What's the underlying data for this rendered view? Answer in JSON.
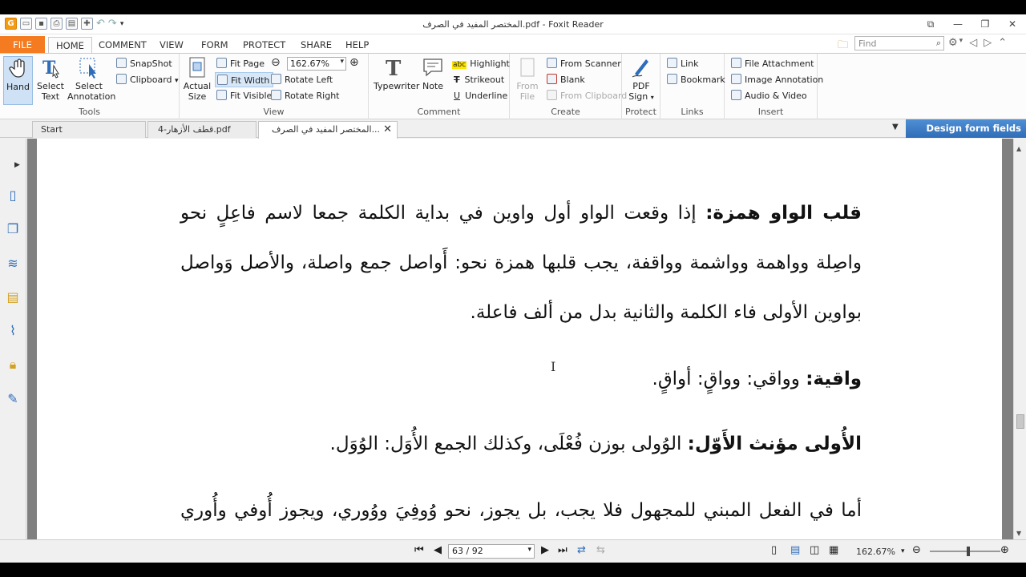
{
  "window": {
    "title": "المختصر المفيد في الصرف.pdf - Foxit Reader"
  },
  "ribbon_tabs": [
    "FILE",
    "HOME",
    "COMMENT",
    "VIEW",
    "FORM",
    "PROTECT",
    "SHARE",
    "HELP"
  ],
  "search": {
    "placeholder": "Find"
  },
  "ribbon": {
    "tools": {
      "label": "Tools",
      "hand": "Hand",
      "select_text": [
        "Select",
        "Text"
      ],
      "select_annotation": [
        "Select",
        "Annotation"
      ],
      "snapshot": "SnapShot",
      "clipboard": "Clipboard"
    },
    "view": {
      "label": "View",
      "actual_size": [
        "Actual",
        "Size"
      ],
      "fit_page": "Fit Page",
      "fit_width": "Fit Width",
      "fit_visible": "Fit Visible",
      "zoom_value": "162.67%",
      "rotate_left": "Rotate Left",
      "rotate_right": "Rotate Right"
    },
    "comment": {
      "label": "Comment",
      "typewriter": "Typewriter",
      "note": "Note",
      "highlight": "Highlight",
      "strikeout": "Strikeout",
      "underline": "Underline"
    },
    "create": {
      "label": "Create",
      "from_file": [
        "From",
        "File"
      ],
      "from_scanner": "From Scanner",
      "blank": "Blank",
      "from_clipboard": "From Clipboard"
    },
    "protect": {
      "label": "Protect",
      "pdf_sign": [
        "PDF",
        "Sign"
      ]
    },
    "links": {
      "label": "Links",
      "link": "Link",
      "bookmark": "Bookmark"
    },
    "insert": {
      "label": "Insert",
      "file_attachment": "File Attachment",
      "image_annotation": "Image Annotation",
      "audio_video": "Audio & Video"
    }
  },
  "doc_tabs": [
    {
      "label": "Start"
    },
    {
      "label": "قطف الأزهار-4.pdf"
    },
    {
      "label": "المختصر المفيد في الصرف..."
    }
  ],
  "banner": "Design form fields easily",
  "document": {
    "paragraphs": [
      {
        "bold": "قلب الواو همزة:",
        "text": " إذا وقعت الواو أول واوين في بداية الكلمة جمعا لاسم فاعِلٍ نحو واصِلة وواهمة وواشمة وواقفة، يجب قلبها همزة نحو: أَواصل جمع واصلة، والأصل وَواصل بواوين الأولى فاء الكلمة والثانية بدل من ألف فاعلة."
      },
      {
        "bold": "واقية:",
        "text": " وواقي: وواقٍ: أواقٍ."
      },
      {
        "bold": "الأُولى مؤنث الأَوّل:",
        "text": " الوُولى بوزن فُعْلَى، وكذلك الجمع الأُوَل: الوُوَل."
      },
      {
        "bold": "",
        "text": "أما في الفعل المبني للمجهول فلا يجب، بل يجوز، نحو وُوفِيَ ووُوري، ويجوز أُوفي وأُوري أيضا، وإذا اجتمع فيه ثلاث واوات وجب قلب الأولى همزة"
      }
    ]
  },
  "statusbar": {
    "page": "63 / 92",
    "zoom": "162.67%"
  }
}
